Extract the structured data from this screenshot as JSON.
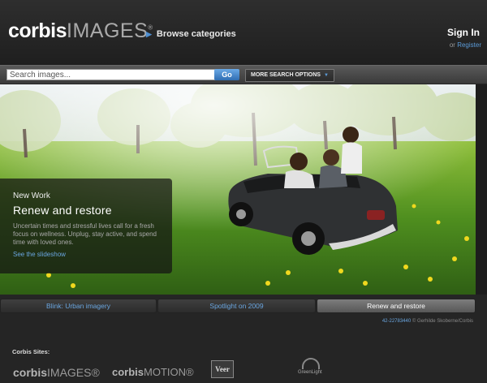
{
  "header": {
    "logo_main": "corbis",
    "logo_sub": "IMAGES",
    "logo_mark": "®",
    "browse_label": "Browse categories",
    "signin_label": "Sign In",
    "register_prefix": "or",
    "register_label": "Register"
  },
  "search": {
    "placeholder": "Search images...",
    "go_label": "Go",
    "more_options_label": "MORE SEARCH OPTIONS"
  },
  "feature": {
    "eyebrow": "New Work",
    "title": "Renew and restore",
    "body": "Uncertain times and stressful lives call for a fresh focus on wellness. Unplug, stay active, and spend time with loved ones.",
    "link": "See the slideshow"
  },
  "tabs": [
    {
      "label": "Blink: Urban imagery",
      "active": false
    },
    {
      "label": "Spotlight on 2009",
      "active": false
    },
    {
      "label": "Renew and restore",
      "active": true
    }
  ],
  "image_credit": {
    "id": "42-22783440",
    "credit": "© Gerhilde Skoberne/Corbis"
  },
  "footer": {
    "sites_label": "Corbis Sites:",
    "sites": [
      {
        "bold": "corbis",
        "rest": "IMAGES®"
      },
      {
        "bold": "corbis",
        "rest": "MOTION®"
      },
      {
        "name": "Veer"
      },
      {
        "name": "GreenLight"
      }
    ]
  },
  "colors": {
    "accent": "#5b9bd8",
    "go_button": "#3a7bc2",
    "background": "#252525"
  }
}
